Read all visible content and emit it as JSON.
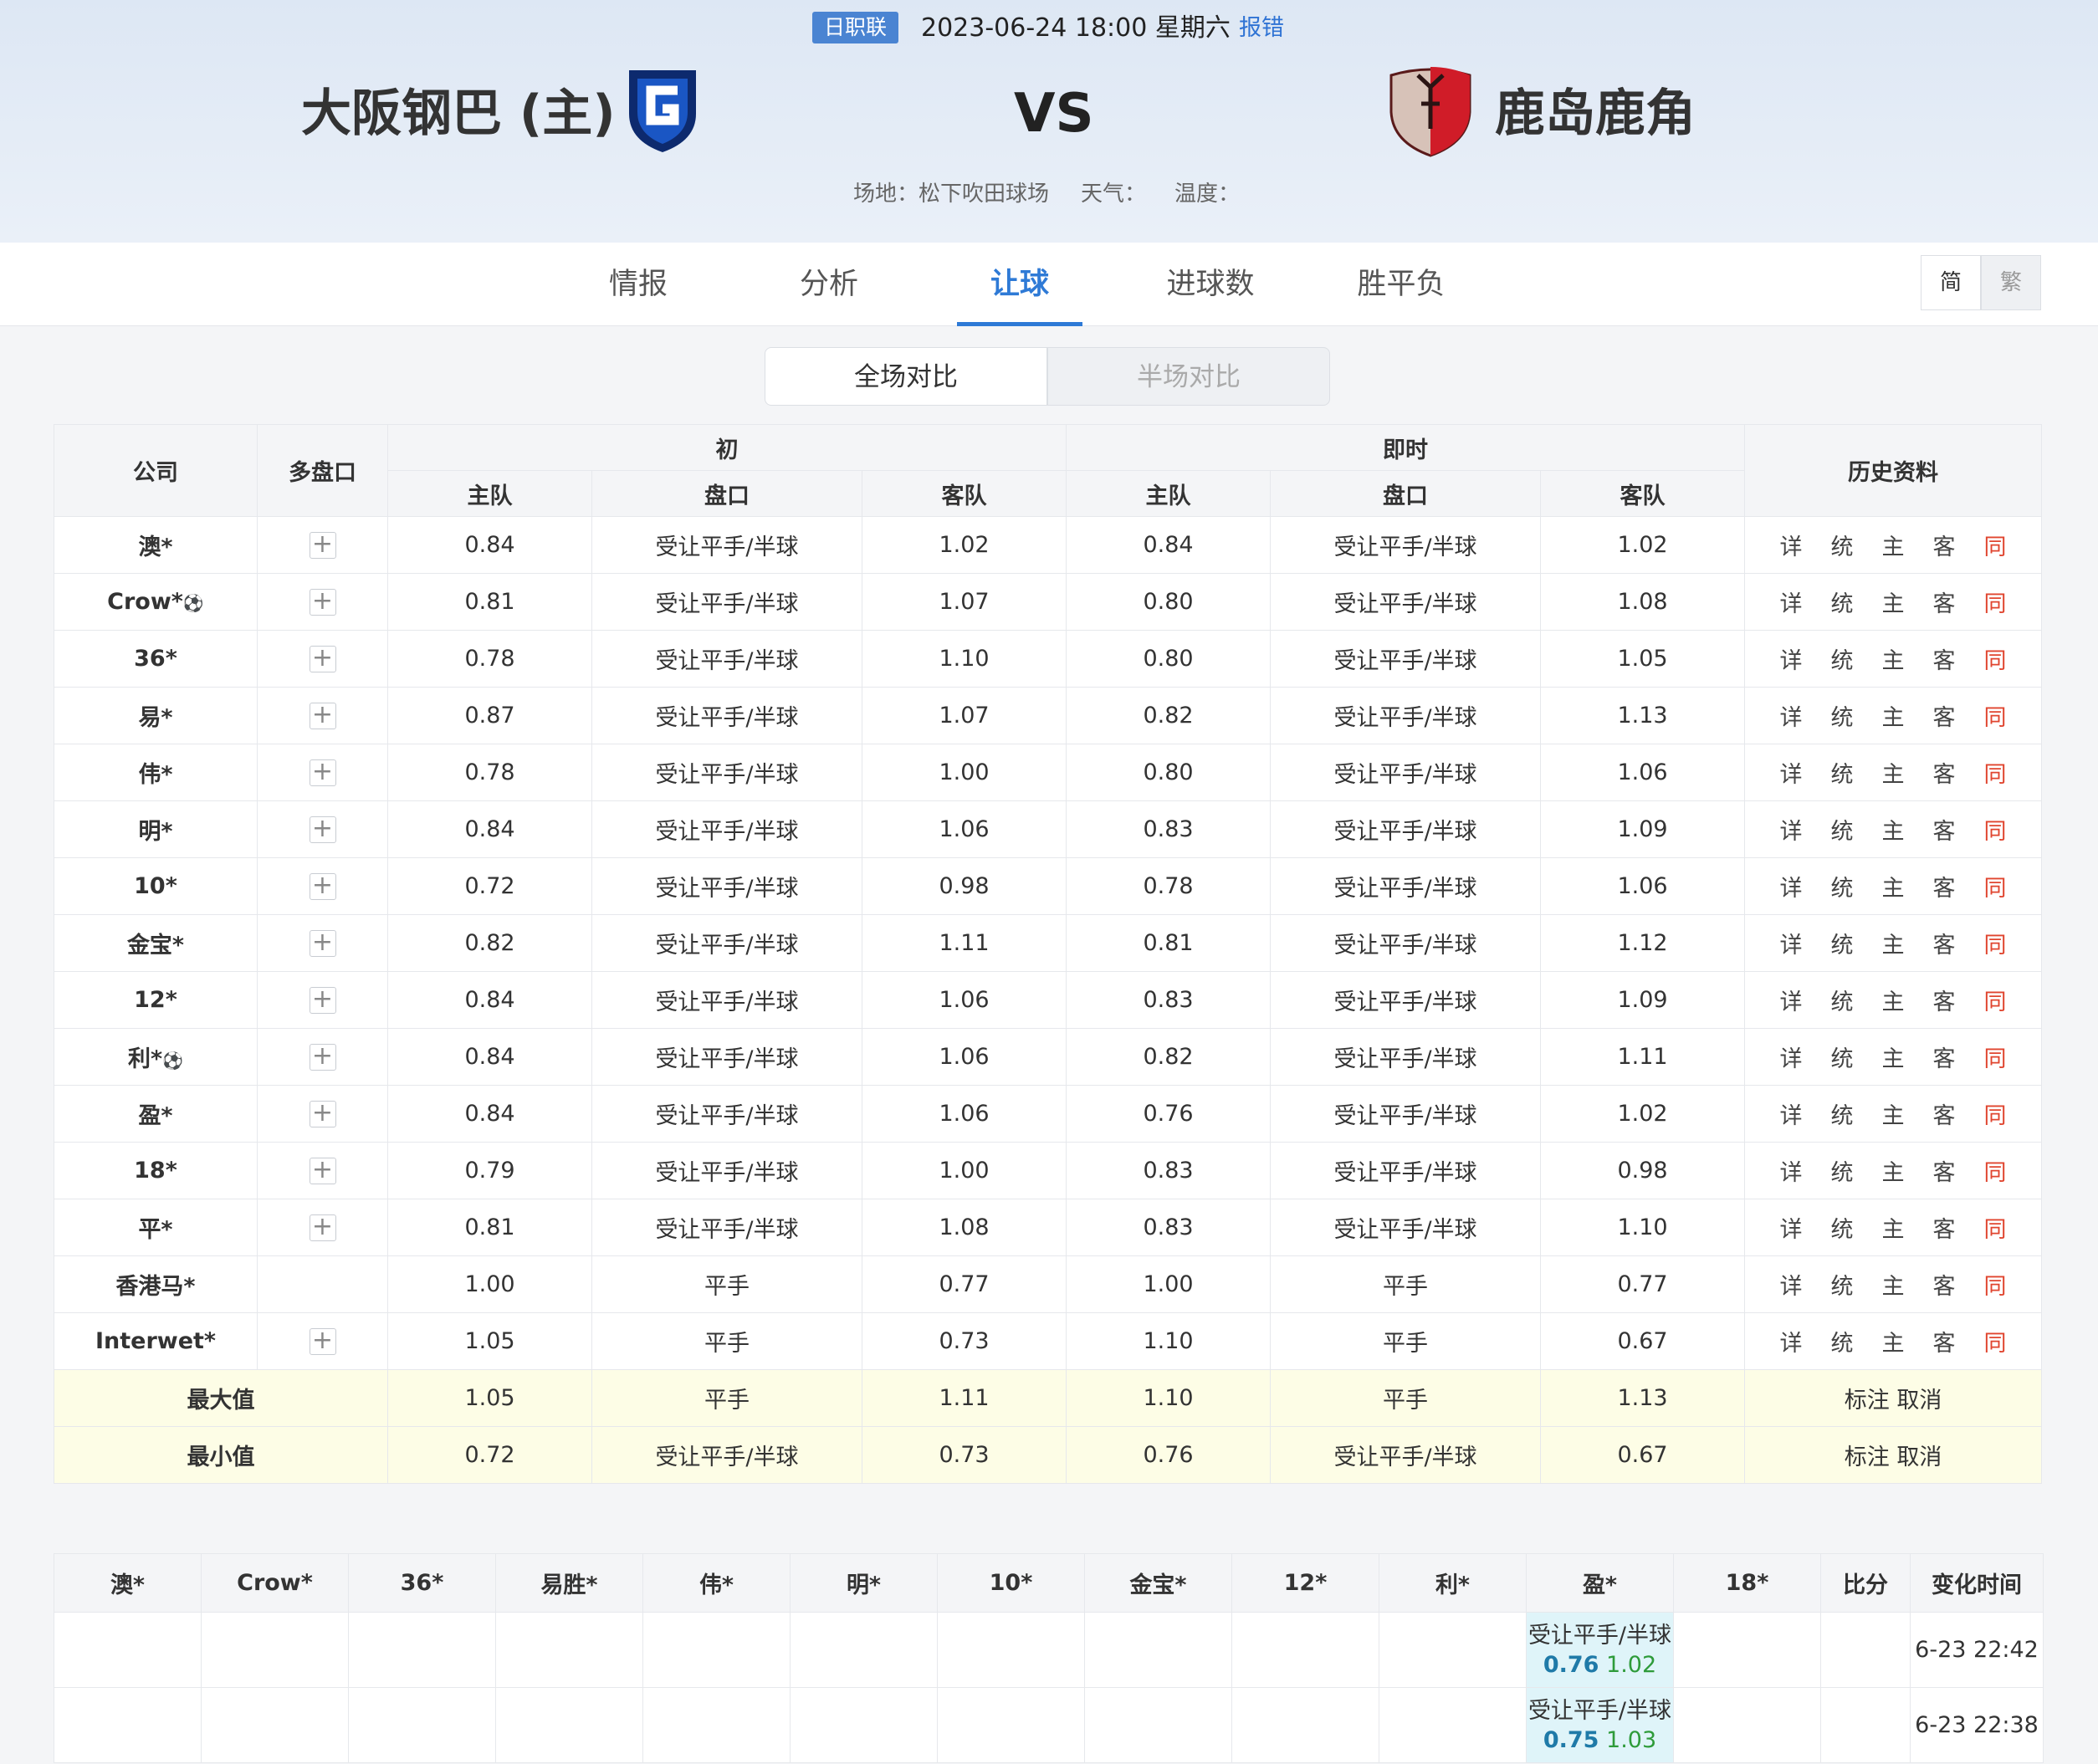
{
  "match": {
    "league": "日职联",
    "datetime": "2023-06-24 18:00 星期六",
    "report": "报错",
    "home": "大阪钢巴 (主)",
    "vs": "VS",
    "away": "鹿岛鹿角",
    "venue": "场地：松下吹田球场",
    "weather": "天气：",
    "temp": "温度："
  },
  "tabs": [
    "情报",
    "分析",
    "让球",
    "进球数",
    "胜平负"
  ],
  "lang": {
    "simplified": "简",
    "traditional": "繁"
  },
  "segments": {
    "full": "全场对比",
    "half": "半场对比"
  },
  "colors": {
    "accent": "#2e7ad6",
    "same": "#e0452f",
    "home_odds": "#1f7aa8",
    "away_odds": "#2e9b3a"
  },
  "odds_table": {
    "headers": {
      "company": "公司",
      "multi": "多盘口",
      "initial": "初",
      "live": "即时",
      "history": "历史资料",
      "home": "主队",
      "line": "盘口",
      "away": "客队"
    },
    "link_labels": [
      "详",
      "统",
      "主",
      "客",
      "同"
    ],
    "rows": [
      {
        "company": "澳*",
        "ball": false,
        "multi": true,
        "i_home": "0.84",
        "i_line": "受让平手/半球",
        "i_away": "1.02",
        "l_home": "0.84",
        "l_line": "受让平手/半球",
        "l_away": "1.02"
      },
      {
        "company": "Crow*",
        "ball": true,
        "multi": true,
        "i_home": "0.81",
        "i_line": "受让平手/半球",
        "i_away": "1.07",
        "l_home": "0.80",
        "l_line": "受让平手/半球",
        "l_away": "1.08"
      },
      {
        "company": "36*",
        "ball": false,
        "multi": true,
        "i_home": "0.78",
        "i_line": "受让平手/半球",
        "i_away": "1.10",
        "l_home": "0.80",
        "l_line": "受让平手/半球",
        "l_away": "1.05"
      },
      {
        "company": "易*",
        "ball": false,
        "multi": true,
        "i_home": "0.87",
        "i_line": "受让平手/半球",
        "i_away": "1.07",
        "l_home": "0.82",
        "l_line": "受让平手/半球",
        "l_away": "1.13"
      },
      {
        "company": "伟*",
        "ball": false,
        "multi": true,
        "i_home": "0.78",
        "i_line": "受让平手/半球",
        "i_away": "1.00",
        "l_home": "0.80",
        "l_line": "受让平手/半球",
        "l_away": "1.06"
      },
      {
        "company": "明*",
        "ball": false,
        "multi": true,
        "i_home": "0.84",
        "i_line": "受让平手/半球",
        "i_away": "1.06",
        "l_home": "0.83",
        "l_line": "受让平手/半球",
        "l_away": "1.09"
      },
      {
        "company": "10*",
        "ball": false,
        "multi": true,
        "i_home": "0.72",
        "i_line": "受让平手/半球",
        "i_away": "0.98",
        "l_home": "0.78",
        "l_line": "受让平手/半球",
        "l_away": "1.06"
      },
      {
        "company": "金宝*",
        "ball": false,
        "multi": true,
        "i_home": "0.82",
        "i_line": "受让平手/半球",
        "i_away": "1.11",
        "l_home": "0.81",
        "l_line": "受让平手/半球",
        "l_away": "1.12"
      },
      {
        "company": "12*",
        "ball": false,
        "multi": true,
        "i_home": "0.84",
        "i_line": "受让平手/半球",
        "i_away": "1.06",
        "l_home": "0.83",
        "l_line": "受让平手/半球",
        "l_away": "1.09"
      },
      {
        "company": "利*",
        "ball": true,
        "multi": true,
        "i_home": "0.84",
        "i_line": "受让平手/半球",
        "i_away": "1.06",
        "l_home": "0.82",
        "l_line": "受让平手/半球",
        "l_away": "1.11"
      },
      {
        "company": "盈*",
        "ball": false,
        "multi": true,
        "i_home": "0.84",
        "i_line": "受让平手/半球",
        "i_away": "1.06",
        "l_home": "0.76",
        "l_line": "受让平手/半球",
        "l_away": "1.02"
      },
      {
        "company": "18*",
        "ball": false,
        "multi": true,
        "i_home": "0.79",
        "i_line": "受让平手/半球",
        "i_away": "1.00",
        "l_home": "0.83",
        "l_line": "受让平手/半球",
        "l_away": "0.98"
      },
      {
        "company": "平*",
        "ball": false,
        "multi": true,
        "i_home": "0.81",
        "i_line": "受让平手/半球",
        "i_away": "1.08",
        "l_home": "0.83",
        "l_line": "受让平手/半球",
        "l_away": "1.10"
      },
      {
        "company": "香港马*",
        "ball": false,
        "multi": false,
        "i_home": "1.00",
        "i_line": "平手",
        "i_away": "0.77",
        "l_home": "1.00",
        "l_line": "平手",
        "l_away": "0.77"
      },
      {
        "company": "Interwet*",
        "ball": false,
        "multi": true,
        "i_home": "1.05",
        "i_line": "平手",
        "i_away": "0.73",
        "l_home": "1.10",
        "l_line": "平手",
        "l_away": "0.67"
      }
    ],
    "max": {
      "label": "最大值",
      "i_home": "1.05",
      "i_line": "平手",
      "i_away": "1.11",
      "l_home": "1.10",
      "l_line": "平手",
      "l_away": "1.13",
      "mark": "标注",
      "cancel": "取消"
    },
    "min": {
      "label": "最小值",
      "i_home": "0.72",
      "i_line": "受让平手/半球",
      "i_away": "0.73",
      "l_home": "0.76",
      "l_line": "受让平手/半球",
      "l_away": "0.67",
      "mark": "标注",
      "cancel": "取消"
    }
  },
  "history_table": {
    "headers": [
      "澳*",
      "Crow*",
      "36*",
      "易胜*",
      "伟*",
      "明*",
      "10*",
      "金宝*",
      "12*",
      "利*",
      "盈*",
      "18*",
      "比分",
      "变化时间"
    ],
    "rows": [
      {
        "col": 10,
        "line": "受让平手/半球",
        "home": "0.76",
        "away": "1.02",
        "time": "6-23 22:42"
      },
      {
        "col": 10,
        "line": "受让平手/半球",
        "home": "0.75",
        "away": "1.03",
        "time": "6-23 22:38"
      }
    ]
  }
}
